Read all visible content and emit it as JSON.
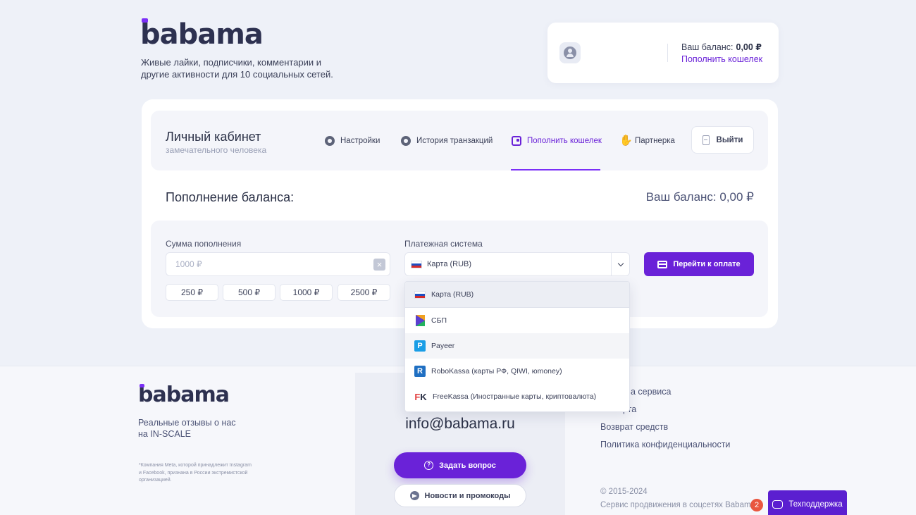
{
  "header": {
    "logo": "babama",
    "tagline": "Живые лайки, подписчики, комментарии и другие активности для 10 социальных сетей.",
    "balance_label": "Ваш баланс:",
    "balance_value": "0,00 ₽",
    "topup_link": "Пополнить кошелек"
  },
  "cabinet": {
    "title": "Личный кабинет",
    "subtitle": "замечательного человека",
    "nav": [
      {
        "label": "Настройки",
        "icon": "gear-icon"
      },
      {
        "label": "История транзакций",
        "icon": "gear-icon"
      },
      {
        "label": "Пополнить кошелек",
        "icon": "wallet-icon",
        "active": true
      },
      {
        "label": "Партнерка",
        "icon": "handshake-icon"
      }
    ],
    "logout": "Выйти"
  },
  "topup": {
    "title": "Пополнение баланса:",
    "balance": "Ваш баланс: 0,00 ₽",
    "amount_label": "Сумма пополнения",
    "amount_placeholder": "1000 ₽",
    "amount_value": "",
    "chips": [
      "250 ₽",
      "500 ₽",
      "1000 ₽",
      "2500 ₽"
    ],
    "payment_label": "Платежная система",
    "payment_selected": "Карта (RUB)",
    "pay_button": "Перейти к оплате",
    "options": [
      {
        "label": "Карта (RUB)",
        "icon": "russia-flag-icon"
      },
      {
        "label": "СБП",
        "icon": "sbp-icon"
      },
      {
        "label": "Payeer",
        "icon": "payeer-icon"
      },
      {
        "label": "RoboKassa (карты РФ, QIWI, юmoney)",
        "icon": "robokassa-icon"
      },
      {
        "label": "FreeKassa (Иностранные карты, криптовалюта)",
        "icon": "freekassa-icon"
      }
    ]
  },
  "footer": {
    "logo": "babama",
    "reviews": "Реальные отзывы о нас на IN-SCALE",
    "disclaimer": "*Компания Meta, которой принадлежит Instagram и Facebook, признана в России экстремистской организацией.",
    "email": "info@babama.ru",
    "ask_button": "Задать вопрос",
    "news_button": "Новости и промокоды",
    "links": [
      "а сервиса",
      "ерта",
      "Возврат средств",
      "Политика конфиденциальности"
    ],
    "copyright_years": "© 2015-2024",
    "copyright_text": "Сервис продвижения в соцсетях Babam",
    "support_button": "Техподдержка",
    "support_badge": "2"
  },
  "colors": {
    "accent": "#6a22d8",
    "background": "#eef1f8",
    "text": "#2b3147"
  }
}
